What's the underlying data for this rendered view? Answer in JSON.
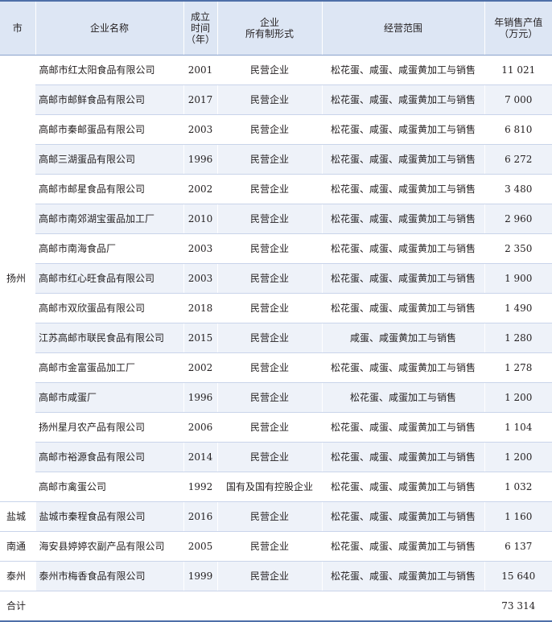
{
  "headers": {
    "city": "市",
    "name": "企业名称",
    "year": [
      "成立",
      "时间",
      "（年）"
    ],
    "ownership": [
      "企业",
      "所有制形式"
    ],
    "scope": "经营范围",
    "sales": [
      "年销售产值",
      "（万元）"
    ]
  },
  "groups": [
    {
      "city": "扬州",
      "rows": [
        {
          "name": "高邮市红太阳食品有限公司",
          "year": "2001",
          "ownership": "民营企业",
          "scope": "松花蛋、咸蛋、咸蛋黄加工与销售",
          "sales": "11 021"
        },
        {
          "name": "高邮市邮鲜食品有限公司",
          "year": "2017",
          "ownership": "民营企业",
          "scope": "松花蛋、咸蛋、咸蛋黄加工与销售",
          "sales": "7 000"
        },
        {
          "name": "高邮市秦邮蛋品有限公司",
          "year": "2003",
          "ownership": "民营企业",
          "scope": "松花蛋、咸蛋、咸蛋黄加工与销售",
          "sales": "6 810"
        },
        {
          "name": "高邮三湖蛋品有限公司",
          "year": "1996",
          "ownership": "民营企业",
          "scope": "松花蛋、咸蛋、咸蛋黄加工与销售",
          "sales": "6 272"
        },
        {
          "name": "高邮市邮星食品有限公司",
          "year": "2002",
          "ownership": "民营企业",
          "scope": "松花蛋、咸蛋、咸蛋黄加工与销售",
          "sales": "3 480"
        },
        {
          "name": "高邮市南郊湖宝蛋品加工厂",
          "year": "2010",
          "ownership": "民营企业",
          "scope": "松花蛋、咸蛋、咸蛋黄加工与销售",
          "sales": "2 960"
        },
        {
          "name": "高邮市南海食品厂",
          "year": "2003",
          "ownership": "民营企业",
          "scope": "松花蛋、咸蛋、咸蛋黄加工与销售",
          "sales": "2 350"
        },
        {
          "name": "高邮市红心旺食品有限公司",
          "year": "2003",
          "ownership": "民营企业",
          "scope": "松花蛋、咸蛋、咸蛋黄加工与销售",
          "sales": "1 900"
        },
        {
          "name": "高邮市双欣蛋品有限公司",
          "year": "2018",
          "ownership": "民营企业",
          "scope": "松花蛋、咸蛋、咸蛋黄加工与销售",
          "sales": "1 490"
        },
        {
          "name": "江苏高邮市联民食品有限公司",
          "year": "2015",
          "ownership": "民营企业",
          "scope": "咸蛋、咸蛋黄加工与销售",
          "sales": "1 280"
        },
        {
          "name": "高邮市金富蛋品加工厂",
          "year": "2002",
          "ownership": "民营企业",
          "scope": "松花蛋、咸蛋、咸蛋黄加工与销售",
          "sales": "1 278"
        },
        {
          "name": "高邮市咸蛋厂",
          "year": "1996",
          "ownership": "民营企业",
          "scope": "松花蛋、咸蛋加工与销售",
          "sales": "1 200"
        },
        {
          "name": "扬州星月农产品有限公司",
          "year": "2006",
          "ownership": "民营企业",
          "scope": "松花蛋、咸蛋、咸蛋黄加工与销售",
          "sales": "1 104"
        },
        {
          "name": "高邮市裕源食品有限公司",
          "year": "2014",
          "ownership": "民营企业",
          "scope": "松花蛋、咸蛋、咸蛋黄加工与销售",
          "sales": "1 200"
        },
        {
          "name": "高邮市禽蛋公司",
          "year": "1992",
          "ownership": "国有及国有控股企业",
          "scope": "松花蛋、咸蛋、咸蛋黄加工与销售",
          "sales": "1 032"
        }
      ]
    },
    {
      "city": "盐城",
      "rows": [
        {
          "name": "盐城市秦程食品有限公司",
          "year": "2016",
          "ownership": "民营企业",
          "scope": "松花蛋、咸蛋、咸蛋黄加工与销售",
          "sales": "1 160"
        }
      ]
    },
    {
      "city": "南通",
      "rows": [
        {
          "name": "海安县婷婷农副产品有限公司",
          "year": "2005",
          "ownership": "民营企业",
          "scope": "松花蛋、咸蛋、咸蛋黄加工与销售",
          "sales": "6 137"
        }
      ]
    },
    {
      "city": "泰州",
      "rows": [
        {
          "name": "泰州市梅香食品有限公司",
          "year": "1999",
          "ownership": "民营企业",
          "scope": "松花蛋、咸蛋、咸蛋黄加工与销售",
          "sales": "15 640"
        }
      ]
    }
  ],
  "total": {
    "label": "合计",
    "sales": "73 314"
  },
  "colors": {
    "header_bg": "#dde6f4",
    "stripe_bg": "#eef2f9",
    "rule": "#4e6fa8"
  }
}
